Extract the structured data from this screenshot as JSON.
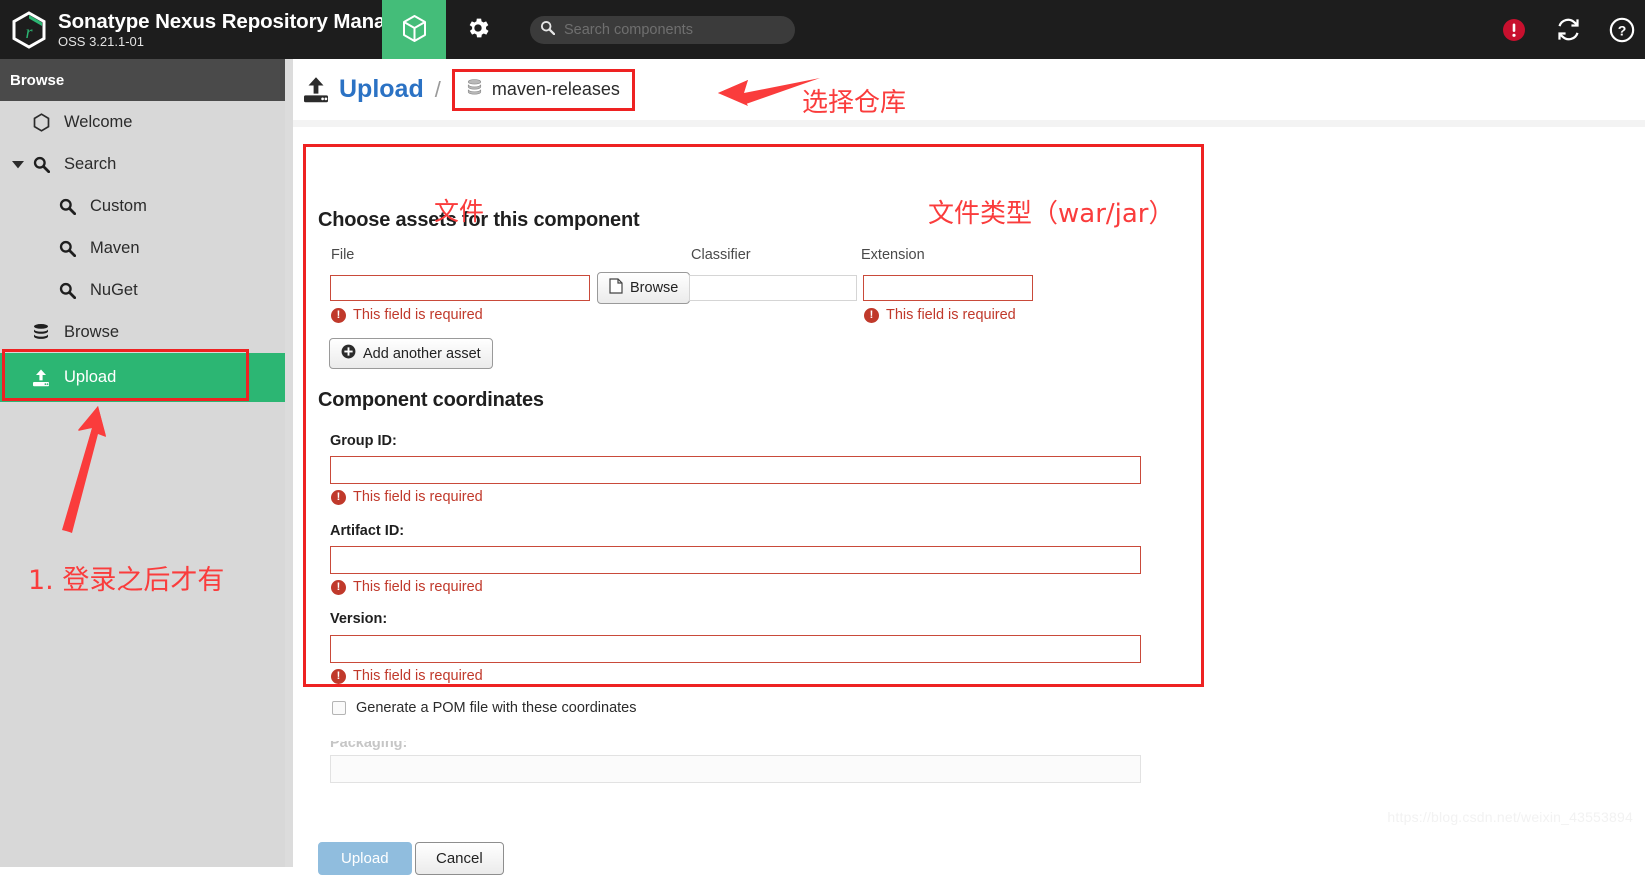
{
  "header": {
    "brand_title": "Sonatype Nexus Repository Manager",
    "brand_subtitle": "OSS 3.21.1-01",
    "logo_icon": "nexus-hexagon-logo-icon",
    "tabs": [
      {
        "name": "browse",
        "icon": "cube-icon",
        "active": true
      },
      {
        "name": "administration",
        "icon": "gear-icon",
        "active": false
      }
    ],
    "search": {
      "placeholder": "Search components",
      "value": "",
      "icon": "search-icon"
    },
    "right_icons": [
      {
        "name": "alert-icon",
        "glyph": "!",
        "color": "#c8102e"
      },
      {
        "name": "refresh-icon",
        "glyph": "refresh",
        "color": "#ffffff"
      },
      {
        "name": "help-icon",
        "glyph": "?",
        "color": "#ffffff"
      }
    ]
  },
  "sidebar": {
    "header": "Browse",
    "items": [
      {
        "label": "Welcome",
        "icon": "hexagon-icon",
        "level": 0,
        "selected": false,
        "caret": ""
      },
      {
        "label": "Search",
        "icon": "search-icon",
        "level": 0,
        "selected": false,
        "caret": "▼"
      },
      {
        "label": "Custom",
        "icon": "search-icon",
        "level": 1,
        "selected": false,
        "caret": ""
      },
      {
        "label": "Maven",
        "icon": "search-icon",
        "level": 1,
        "selected": false,
        "caret": ""
      },
      {
        "label": "NuGet",
        "icon": "search-icon",
        "level": 1,
        "selected": false,
        "caret": ""
      },
      {
        "label": "Browse",
        "icon": "database-icon",
        "level": 0,
        "selected": false,
        "caret": ""
      },
      {
        "label": "Upload",
        "icon": "upload-icon",
        "level": 0,
        "selected": true,
        "caret": ""
      }
    ]
  },
  "breadcrumb": {
    "title": "Upload",
    "separator": "/",
    "repository": "maven-releases",
    "repo_icon": "database-icon",
    "title_icon": "upload-icon"
  },
  "assets_section": {
    "heading": "Choose assets for this component",
    "labels": {
      "file": "File",
      "classifier": "Classifier",
      "extension": "Extension"
    },
    "file_value": "",
    "classifier_value": "",
    "extension_value": "",
    "browse_label": "Browse",
    "browse_icon": "file-icon",
    "add_asset_label": "Add another asset",
    "add_asset_icon": "plus-circle-icon",
    "error_file": "This field is required",
    "error_extension": "This field is required"
  },
  "coordinates_section": {
    "heading": "Component coordinates",
    "fields": [
      {
        "label": "Group ID:",
        "value": "",
        "error": "This field is required"
      },
      {
        "label": "Artifact ID:",
        "value": "",
        "error": "This field is required"
      },
      {
        "label": "Version:",
        "value": "",
        "error": "This field is required"
      }
    ],
    "generate_pom_label": "Generate a POM file with these coordinates",
    "generate_pom_checked": false,
    "packaging_label": "Packaging:",
    "packaging_value": ""
  },
  "footer": {
    "upload_label": "Upload",
    "cancel_label": "Cancel"
  },
  "annotations": [
    {
      "name": "select-repository-note",
      "text": "选择仓库"
    },
    {
      "name": "file-note",
      "text": "文件"
    },
    {
      "name": "file-type-note",
      "text": "文件类型（war/jar）"
    },
    {
      "name": "login-required-note",
      "text": "1. 登录之后才有"
    }
  ],
  "watermark": "https://blog.csdn.net/weixin_43553894",
  "colors": {
    "accent_green": "#2cb673",
    "link_blue": "#2b72c4",
    "error_red": "#c0392b",
    "annotation_red": "#fa3c3c",
    "topbar_dark": "#1d1d1d",
    "upload_button_blue": "#90bdde"
  }
}
